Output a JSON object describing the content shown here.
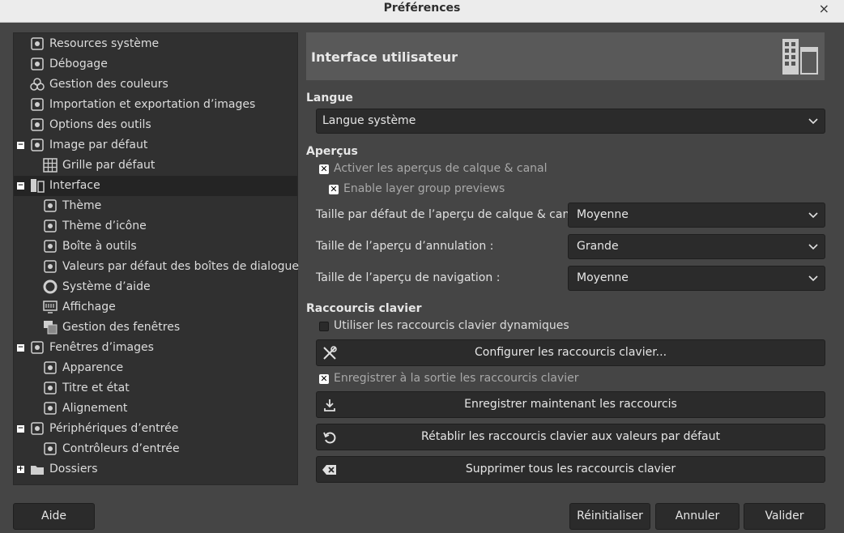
{
  "window": {
    "title": "Préférences",
    "close": "×"
  },
  "tree": [
    {
      "label": "Resources système",
      "icon": "chip-icon",
      "indent": 0,
      "exp": ""
    },
    {
      "label": "Débogage",
      "icon": "wilber-icon",
      "indent": 0,
      "exp": ""
    },
    {
      "label": "Gestion des couleurs",
      "icon": "color-circles-icon",
      "indent": 0,
      "exp": ""
    },
    {
      "label": "Importation et exportation d’images",
      "icon": "import-export-icon",
      "indent": 0,
      "exp": ""
    },
    {
      "label": "Options des outils",
      "icon": "tool-options-icon",
      "indent": 0,
      "exp": ""
    },
    {
      "label": "Image par défaut",
      "icon": "image-star-icon",
      "indent": 0,
      "exp": "−"
    },
    {
      "label": "Grille par défaut",
      "icon": "grid-icon",
      "indent": 1,
      "exp": ""
    },
    {
      "label": "Interface",
      "icon": "interface-icon",
      "indent": 0,
      "exp": "−",
      "selected": true
    },
    {
      "label": "Thème",
      "icon": "theme-icon",
      "indent": 1,
      "exp": ""
    },
    {
      "label": "Thème d’icône",
      "icon": "icon-theme-icon",
      "indent": 1,
      "exp": ""
    },
    {
      "label": "Boîte à outils",
      "icon": "toolbox-icon",
      "indent": 1,
      "exp": ""
    },
    {
      "label": "Valeurs par défaut des boîtes de dialogue",
      "icon": "dialog-defaults-icon",
      "indent": 1,
      "exp": ""
    },
    {
      "label": "Système d’aide",
      "icon": "help-ring-icon",
      "indent": 1,
      "exp": ""
    },
    {
      "label": "Affichage",
      "icon": "display-icon",
      "indent": 1,
      "exp": ""
    },
    {
      "label": "Gestion des fenêtres",
      "icon": "windows-icon",
      "indent": 1,
      "exp": ""
    },
    {
      "label": "Fenêtres d’images",
      "icon": "image-window-icon",
      "indent": 0,
      "exp": "−"
    },
    {
      "label": "Apparence",
      "icon": "appearance-icon",
      "indent": 1,
      "exp": ""
    },
    {
      "label": "Titre et état",
      "icon": "title-status-icon",
      "indent": 1,
      "exp": ""
    },
    {
      "label": "Alignement",
      "icon": "snapping-icon",
      "indent": 1,
      "exp": ""
    },
    {
      "label": "Périphériques d’entrée",
      "icon": "input-devices-icon",
      "indent": 0,
      "exp": "−"
    },
    {
      "label": "Contrôleurs d’entrée",
      "icon": "controllers-icon",
      "indent": 1,
      "exp": ""
    },
    {
      "label": "Dossiers",
      "icon": "folders-icon",
      "indent": 0,
      "exp": "+"
    }
  ],
  "panel": {
    "title": "Interface utilisateur",
    "icon": "interface-large-icon",
    "langue": {
      "heading": "Langue",
      "value": "Langue système"
    },
    "apercus": {
      "heading": "Aperçus",
      "check1": {
        "label": "Activer les aperçus de calque & canal",
        "checked": true,
        "mark": "✕"
      },
      "check2": {
        "label": "Enable layer group previews",
        "checked": true,
        "mark": "✕"
      },
      "rows": [
        {
          "label": "Taille par défaut de l’aperçu de calque & canal :",
          "value": "Moyenne"
        },
        {
          "label": "Taille de l’aperçu d’annulation :",
          "value": "Grande"
        },
        {
          "label": "Taille de l’aperçu de navigation :",
          "value": "Moyenne"
        }
      ]
    },
    "raccourcis": {
      "heading": "Raccourcis clavier",
      "dynamic": {
        "label": "Utiliser les raccourcis clavier dynamiques",
        "checked": false
      },
      "configure": {
        "label": "Configurer les raccourcis clavier...",
        "icon": "tools-icon"
      },
      "save_on_exit": {
        "label": "Enregistrer à la sortie les raccourcis clavier",
        "checked": true,
        "mark": "✕"
      },
      "save_now": {
        "label": "Enregistrer maintenant les raccourcis",
        "icon": "save-download-icon"
      },
      "reset": {
        "label": "Rétablir les raccourcis clavier aux valeurs par défaut",
        "icon": "reset-icon"
      },
      "clear": {
        "label": "Supprimer tous les raccourcis clavier",
        "icon": "backspace-icon"
      }
    }
  },
  "footer": {
    "help": "Aide",
    "reset": "Réinitialiser",
    "cancel": "Annuler",
    "ok": "Valider"
  }
}
